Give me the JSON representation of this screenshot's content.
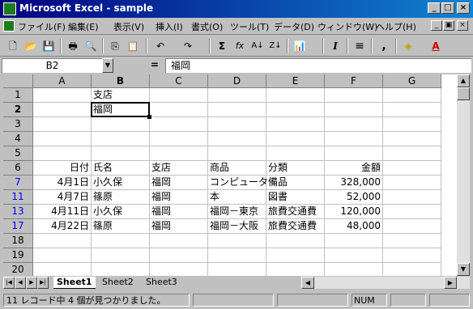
{
  "window": {
    "title": "Microsoft Excel - sample",
    "controls": [
      "_",
      "□",
      "×"
    ]
  },
  "menu": {
    "items": [
      "ファイル(F)",
      "編集(E)",
      "表示(V)",
      "挿入(I)",
      "書式(O)",
      "ツール(T)",
      "データ(D)",
      "ウィンドウ(W)",
      "ヘルプ(H)"
    ],
    "doc_controls": [
      "_",
      "▣",
      "×"
    ]
  },
  "toolbar": {
    "items": [
      {
        "name": "new-icon",
        "glyph": "🗋"
      },
      {
        "name": "open-icon",
        "glyph": "📂"
      },
      {
        "name": "save-icon",
        "glyph": "💾"
      },
      {
        "name": "print-icon",
        "glyph": "🖶"
      },
      {
        "name": "print-preview-icon",
        "glyph": "🔍"
      },
      {
        "name": "copy-icon",
        "glyph": "⎘"
      },
      {
        "name": "paste-icon",
        "glyph": "📋"
      },
      {
        "name": "undo-icon",
        "glyph": "↶"
      },
      {
        "name": "redo-icon",
        "glyph": "↷"
      },
      {
        "name": "autosum-icon",
        "glyph": "Σ"
      },
      {
        "name": "function-icon",
        "glyph": "fx"
      },
      {
        "name": "sort-ascending-icon",
        "glyph": "A↓"
      },
      {
        "name": "sort-descending-icon",
        "glyph": "Z↓"
      },
      {
        "name": "chart-wizard-icon",
        "glyph": "📊"
      },
      {
        "name": "italic-icon",
        "glyph": "I"
      },
      {
        "name": "align-center-icon",
        "glyph": "≡"
      },
      {
        "name": "comma-style-icon",
        "glyph": ","
      },
      {
        "name": "fill-color-icon",
        "glyph": "◈"
      },
      {
        "name": "font-color-icon",
        "glyph": "A"
      }
    ]
  },
  "formula_bar": {
    "name_box": "B2",
    "equals": "=",
    "value": "福岡"
  },
  "grid": {
    "columns": [
      "A",
      "B",
      "C",
      "D",
      "E",
      "F",
      "G"
    ],
    "rows": [
      {
        "num": "1",
        "blue": false,
        "cells": [
          "",
          "支店",
          "",
          "",
          "",
          "",
          ""
        ]
      },
      {
        "num": "2",
        "blue": false,
        "cells": [
          "",
          "福岡",
          "",
          "",
          "",
          "",
          ""
        ]
      },
      {
        "num": "3",
        "blue": false,
        "cells": [
          "",
          "",
          "",
          "",
          "",
          "",
          ""
        ]
      },
      {
        "num": "4",
        "blue": false,
        "cells": [
          "",
          "",
          "",
          "",
          "",
          "",
          ""
        ]
      },
      {
        "num": "5",
        "blue": false,
        "cells": [
          "",
          "",
          "",
          "",
          "",
          "",
          ""
        ]
      },
      {
        "num": "6",
        "blue": false,
        "cells": [
          "日付",
          "氏名",
          "支店",
          "商品",
          "分類",
          "金額",
          ""
        ]
      },
      {
        "num": "7",
        "blue": true,
        "cells": [
          "4月1日",
          "小久保",
          "福岡",
          "コンピュータ",
          "備品",
          "328,000",
          ""
        ]
      },
      {
        "num": "11",
        "blue": true,
        "cells": [
          "4月7日",
          "篠原",
          "福岡",
          "本",
          "図書",
          "52,000",
          ""
        ]
      },
      {
        "num": "13",
        "blue": true,
        "cells": [
          "4月11日",
          "小久保",
          "福岡",
          "福岡－東京",
          "旅費交通費",
          "120,000",
          ""
        ]
      },
      {
        "num": "17",
        "blue": true,
        "cells": [
          "4月22日",
          "篠原",
          "福岡",
          "福岡－大阪",
          "旅費交通費",
          "48,000",
          ""
        ]
      },
      {
        "num": "18",
        "blue": false,
        "cells": [
          "",
          "",
          "",
          "",
          "",
          "",
          ""
        ]
      },
      {
        "num": "19",
        "blue": false,
        "cells": [
          "",
          "",
          "",
          "",
          "",
          "",
          ""
        ]
      },
      {
        "num": "20",
        "blue": false,
        "cells": [
          "",
          "",
          "",
          "",
          "",
          "",
          ""
        ]
      }
    ],
    "right_aligned_columns": [
      "A",
      "F"
    ],
    "active_cell": "B2"
  },
  "sheets": {
    "tabs": [
      "Sheet1",
      "Sheet2",
      "Sheet3"
    ],
    "active": "Sheet1"
  },
  "status": {
    "message": "11 レコード中 4 個が見つかりました。",
    "indicator": "NUM"
  },
  "colors": {
    "title_start": "#000080",
    "title_end": "#1084d0",
    "filtered_row_number": "#0000ff"
  }
}
